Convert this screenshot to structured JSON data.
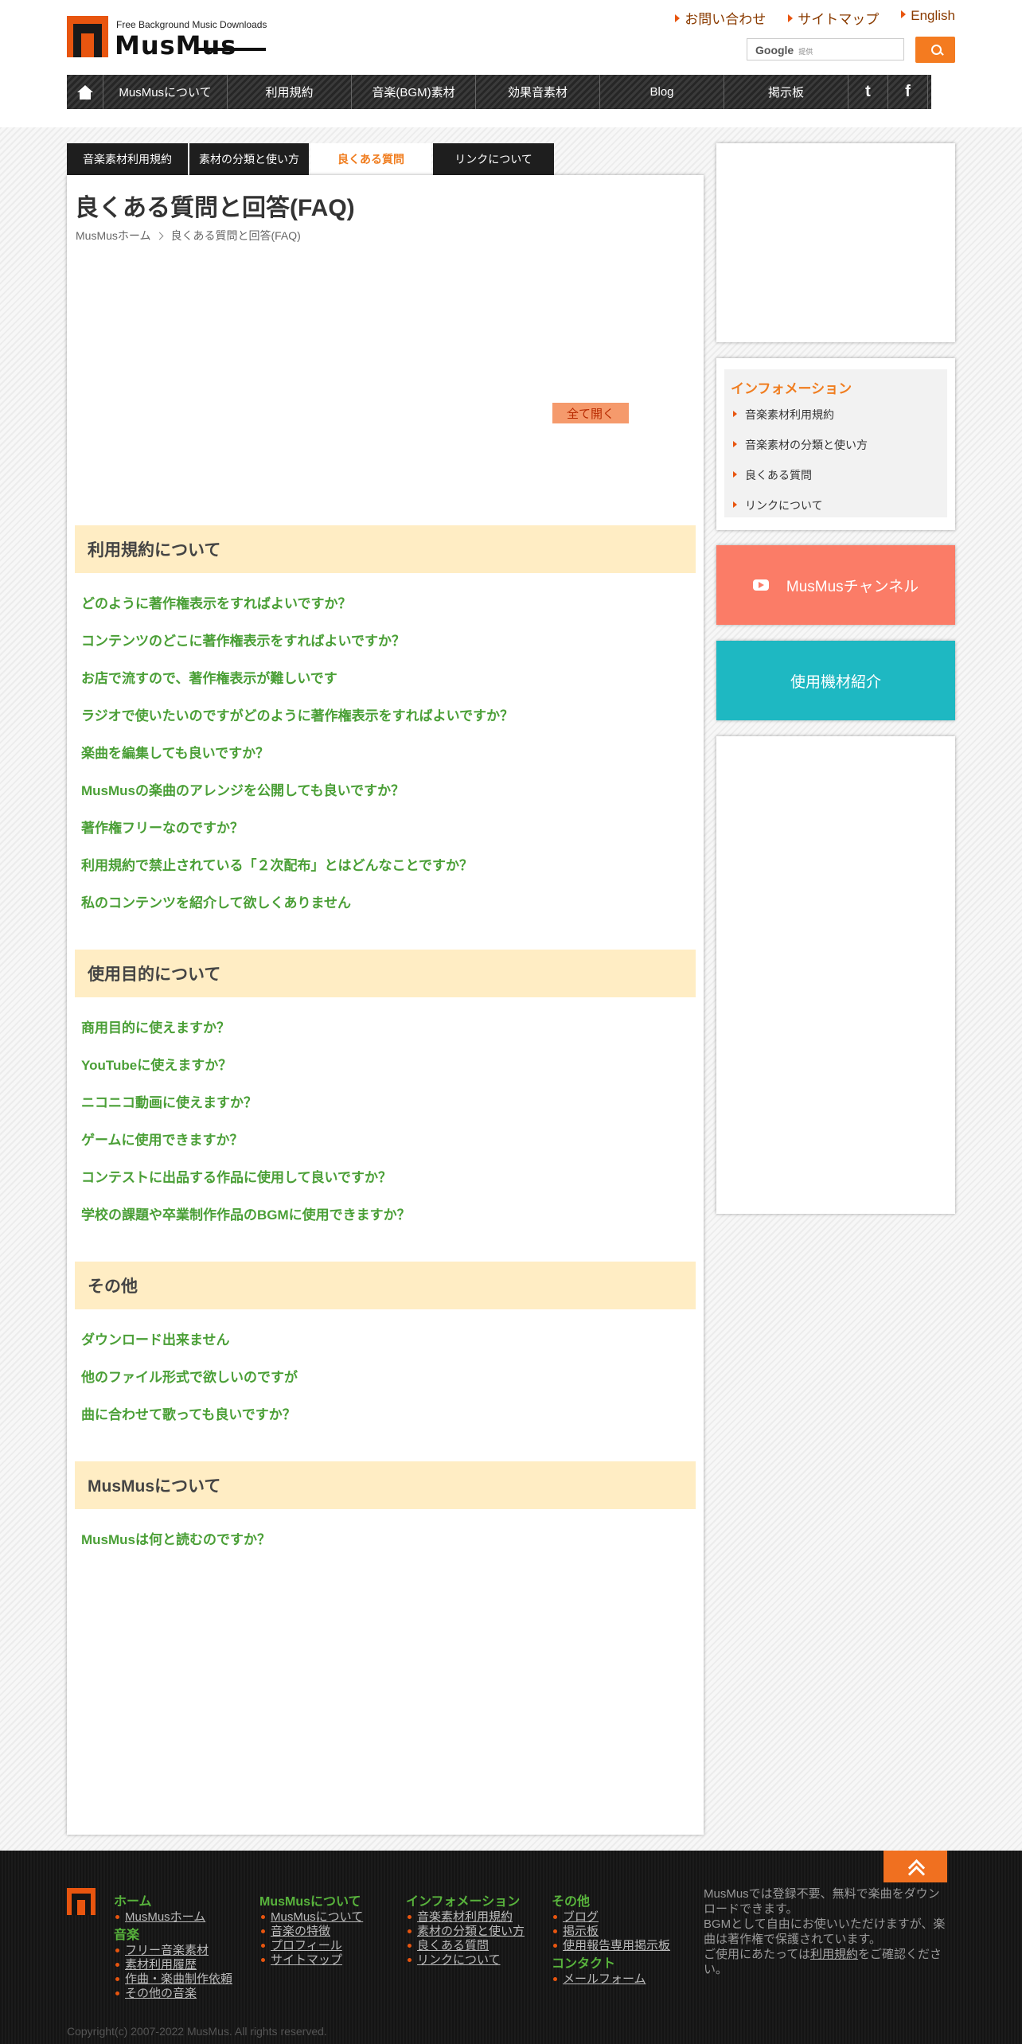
{
  "header": {
    "logo_tagline": "Free Background Music Downloads",
    "logo_name": "MusMus",
    "top_links": [
      "お問い合わせ",
      "サイトマップ",
      "English"
    ],
    "search_brand": "Google",
    "search_sub": "提供",
    "nav": [
      "MusMusについて",
      "利用規約",
      "音楽(BGM)素材",
      "効果音素材",
      "Blog",
      "掲示板"
    ],
    "social": [
      "twitter-icon",
      "facebook-icon"
    ]
  },
  "tabs": [
    "音楽素材利用規約",
    "素材の分類と使い方",
    "良くある質問",
    "リンクについて"
  ],
  "page": {
    "title": "良くある質問と回答(FAQ)",
    "breadcrumb_home": "MusMusホーム",
    "breadcrumb_current": "良くある質問と回答(FAQ)",
    "expand_all": "全て開く"
  },
  "sections": [
    {
      "title": "利用規約について",
      "questions": [
        "どのように著作権表示をすればよいですか？",
        "コンテンツのどこに著作権表示をすればよいですか？",
        "お店で流すので、著作権表示が難しいです",
        "ラジオで使いたいのですがどのように著作権表示をすればよいですか？",
        "楽曲を編集しても良いですか？",
        "MusMusの楽曲のアレンジを公開しても良いですか？",
        "著作権フリーなのですか？",
        "利用規約で禁止されている「２次配布」とはどんなことですか？",
        "私のコンテンツを紹介して欲しくありません"
      ]
    },
    {
      "title": "使用目的について",
      "questions": [
        "商用目的に使えますか？",
        "YouTubeに使えますか？",
        "ニコニコ動画に使えますか？",
        "ゲームに使用できますか？",
        "コンテストに出品する作品に使用して良いですか？",
        "学校の課題や卒業制作作品のBGMに使用できますか？"
      ]
    },
    {
      "title": "その他",
      "questions": [
        "ダウンロード出来ません",
        "他のファイル形式で欲しいのですが",
        "曲に合わせて歌っても良いですか？"
      ]
    },
    {
      "title": "MusMusについて",
      "questions": [
        "MusMusは何と読むのですか？"
      ]
    }
  ],
  "sidebar": {
    "info_title": "インフォメーション",
    "info_items": [
      "音楽素材利用規約",
      "音楽素材の分類と使い方",
      "良くある質問",
      "リンクについて"
    ],
    "channel": "MusMusチャンネル",
    "equipment": "使用機材紹介"
  },
  "footer": {
    "col1_h1": "ホーム",
    "col1_l1": [
      "MusMusホーム"
    ],
    "col1_h2": "音楽",
    "col1_l2": [
      "フリー音楽素材",
      "素材利用履歴",
      "作曲・楽曲制作依頼",
      "その他の音楽"
    ],
    "col2_h": "MusMusについて",
    "col2_l": [
      "MusMusについて",
      "音楽の特徴",
      "プロフィール",
      "サイトマップ"
    ],
    "col3_h": "インフォメーション",
    "col3_l": [
      "音楽素材利用規約",
      "素材の分類と使い方",
      "良くある質問",
      "リンクについて"
    ],
    "col4_h1": "その他",
    "col4_l1": [
      "ブログ",
      "掲示板",
      "使用報告専用掲示板"
    ],
    "col4_h2": "コンタクト",
    "col4_l2": [
      "メールフォーム"
    ],
    "note_1": "MusMusでは登録不要、無料で楽曲をダウンロードできます。",
    "note_2": "BGMとして自由にお使いいただけますが、楽曲は著作権で保護されています。",
    "note_3a": "ご使用にあたっては",
    "note_3link": "利用規約",
    "note_3b": "をご確認ください。",
    "copyright": "Copyright(c) 2007-2022 MusMus. All rights reserved."
  }
}
